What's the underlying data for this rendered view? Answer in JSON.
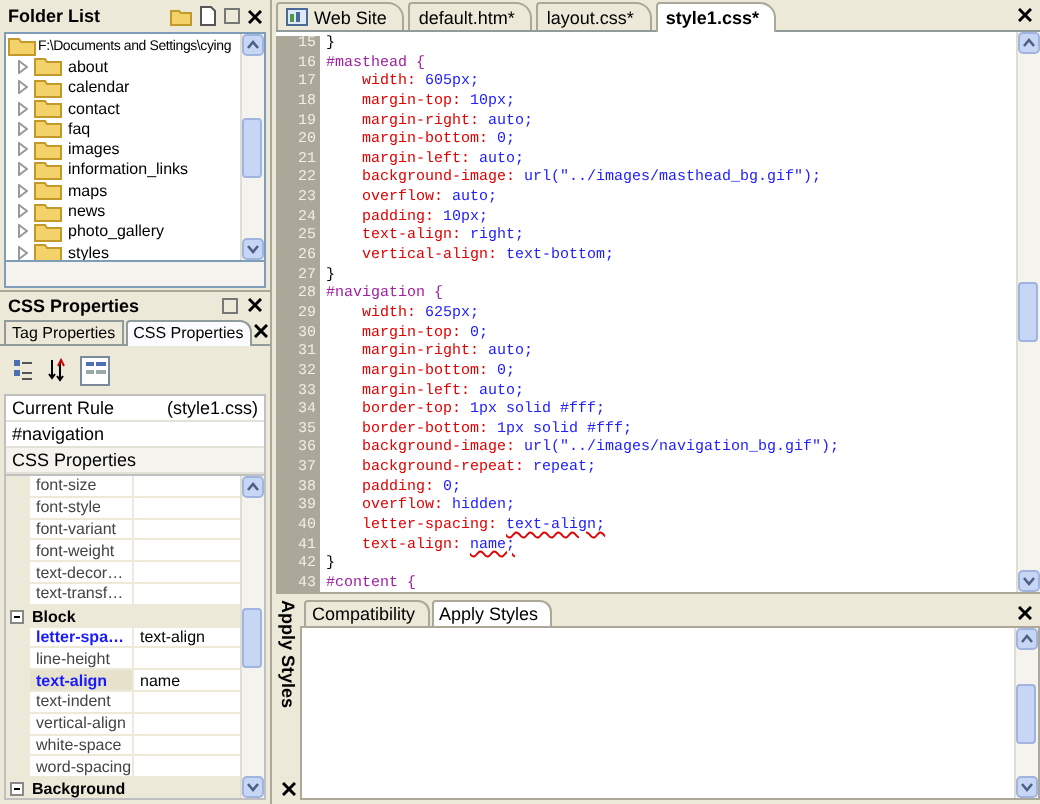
{
  "folder_list": {
    "title": "Folder List",
    "root": "F:\\Documents and Settings\\cying",
    "items": [
      {
        "label": "about"
      },
      {
        "label": "calendar"
      },
      {
        "label": "contact"
      },
      {
        "label": "faq"
      },
      {
        "label": "images"
      },
      {
        "label": "information_links"
      },
      {
        "label": "maps"
      },
      {
        "label": "news"
      },
      {
        "label": "photo_gallery"
      },
      {
        "label": "styles"
      }
    ]
  },
  "css_properties": {
    "title": "CSS Properties",
    "tabs": [
      {
        "label": "Tag Properties",
        "selected": false
      },
      {
        "label": "CSS Properties",
        "selected": true
      }
    ],
    "toolbar": [
      {
        "kind": "categorized",
        "selected": false
      },
      {
        "kind": "sort",
        "selected": false
      },
      {
        "kind": "show-set",
        "selected": true
      }
    ],
    "current_rule": {
      "label": "Current Rule",
      "source": "(style1.css)"
    },
    "selector": "#navigation",
    "grid_heading": "CSS Properties",
    "rows": [
      {
        "kind": "property",
        "name": "font-size",
        "set": false,
        "selected": false
      },
      {
        "kind": "property",
        "name": "font-style",
        "set": false,
        "selected": false
      },
      {
        "kind": "property",
        "name": "font-variant",
        "set": false,
        "selected": false
      },
      {
        "kind": "property",
        "name": "font-weight",
        "set": false,
        "selected": false
      },
      {
        "kind": "property",
        "name": "text-decor…",
        "set": false,
        "selected": false
      },
      {
        "kind": "property",
        "name": "text-transf…",
        "set": false,
        "selected": false
      },
      {
        "kind": "group",
        "name": "Block",
        "expanded": true
      },
      {
        "kind": "property",
        "name": "letter-spa…",
        "value": "text-align",
        "set": true,
        "selected": false
      },
      {
        "kind": "property",
        "name": "line-height",
        "set": false,
        "selected": false
      },
      {
        "kind": "property",
        "name": "text-align",
        "value": "name",
        "set": true,
        "selected": true
      },
      {
        "kind": "property",
        "name": "text-indent",
        "set": false,
        "selected": false
      },
      {
        "kind": "property",
        "name": "vertical-align",
        "set": false,
        "selected": false
      },
      {
        "kind": "property",
        "name": "white-space",
        "set": false,
        "selected": false
      },
      {
        "kind": "property",
        "name": "word-spacing",
        "set": false,
        "selected": false
      },
      {
        "kind": "group",
        "name": "Background",
        "expanded": true
      }
    ]
  },
  "editor": {
    "tabs": [
      {
        "label": "Web Site",
        "kind": "site",
        "selected": false
      },
      {
        "label": "default.htm*",
        "kind": "file",
        "selected": false
      },
      {
        "label": "layout.css*",
        "kind": "file",
        "selected": false
      },
      {
        "label": "style1.css*",
        "kind": "file",
        "selected": true
      }
    ],
    "lines": [
      {
        "number": "15",
        "kind": "brace",
        "text": "}"
      },
      {
        "number": "16",
        "kind": "selector",
        "text": "#masthead {"
      },
      {
        "number": "17",
        "kind": "decl",
        "property": "width:",
        "value": "605px;"
      },
      {
        "number": "18",
        "kind": "decl",
        "property": "margin-top:",
        "value": "10px;"
      },
      {
        "number": "19",
        "kind": "decl",
        "property": "margin-right:",
        "value": "auto;"
      },
      {
        "number": "20",
        "kind": "decl",
        "property": "margin-bottom:",
        "value": "0;"
      },
      {
        "number": "21",
        "kind": "decl",
        "property": "margin-left:",
        "value": "auto;"
      },
      {
        "number": "22",
        "kind": "decl",
        "property": "background-image:",
        "value": "url(\"../images/masthead_bg.gif\");"
      },
      {
        "number": "23",
        "kind": "decl",
        "property": "overflow:",
        "value": "auto;"
      },
      {
        "number": "24",
        "kind": "decl",
        "property": "padding:",
        "value": "10px;"
      },
      {
        "number": "25",
        "kind": "decl",
        "property": "text-align:",
        "value": "right;"
      },
      {
        "number": "26",
        "kind": "decl",
        "property": "vertical-align:",
        "value": "text-bottom;"
      },
      {
        "number": "27",
        "kind": "brace",
        "text": "}"
      },
      {
        "number": "28",
        "kind": "selector",
        "text": "#navigation {"
      },
      {
        "number": "29",
        "kind": "decl",
        "property": "width:",
        "value": "625px;"
      },
      {
        "number": "30",
        "kind": "decl",
        "property": "margin-top:",
        "value": "0;"
      },
      {
        "number": "31",
        "kind": "decl",
        "property": "margin-right:",
        "value": "auto;"
      },
      {
        "number": "32",
        "kind": "decl",
        "property": "margin-bottom:",
        "value": "0;"
      },
      {
        "number": "33",
        "kind": "decl",
        "property": "margin-left:",
        "value": "auto;"
      },
      {
        "number": "34",
        "kind": "decl",
        "property": "border-top:",
        "value": "1px solid #fff;"
      },
      {
        "number": "35",
        "kind": "decl",
        "property": "border-bottom:",
        "value": "1px solid #fff;"
      },
      {
        "number": "36",
        "kind": "decl",
        "property": "background-image:",
        "value": "url(\"../images/navigation_bg.gif\");"
      },
      {
        "number": "37",
        "kind": "decl",
        "property": "background-repeat:",
        "value": "repeat;"
      },
      {
        "number": "38",
        "kind": "decl",
        "property": "padding:",
        "value": "0;"
      },
      {
        "number": "39",
        "kind": "decl",
        "property": "overflow:",
        "value": "hidden;"
      },
      {
        "number": "40",
        "kind": "decl",
        "property": "letter-spacing:",
        "value": "text-align;",
        "error": true
      },
      {
        "number": "41",
        "kind": "decl",
        "property": "text-align:",
        "value": "name;",
        "error": true
      },
      {
        "number": "42",
        "kind": "brace",
        "text": "}"
      },
      {
        "number": "43",
        "kind": "selector",
        "text": "#content {"
      }
    ]
  },
  "bottom_panel": {
    "side_label": "Apply Styles",
    "tabs": [
      {
        "label": "Compatibility",
        "selected": false
      },
      {
        "label": "Apply Styles",
        "selected": true
      }
    ]
  }
}
